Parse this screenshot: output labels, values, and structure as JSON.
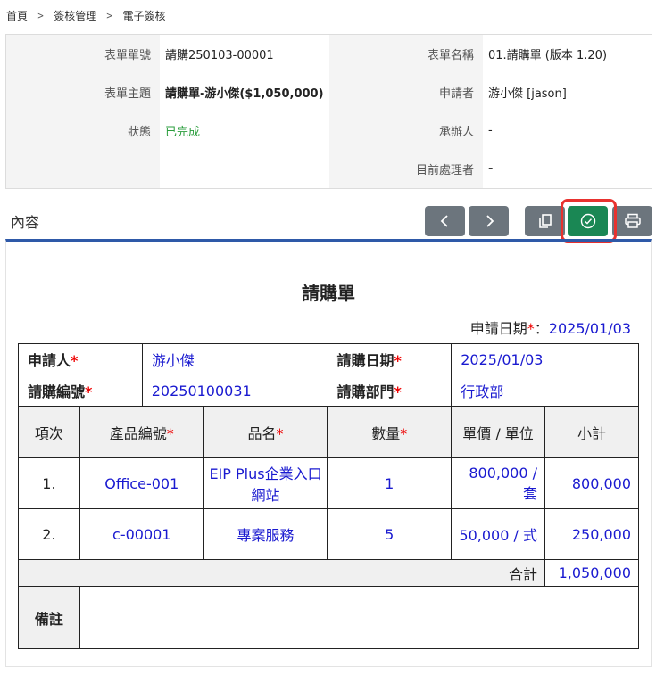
{
  "breadcrumb": {
    "home": "首頁",
    "sep": ">",
    "module": "簽核管理",
    "current": "電子簽核"
  },
  "info": {
    "form_no_label": "表單單號",
    "form_no": "請購250103-00001",
    "form_name_label": "表單名稱",
    "form_name": "01.請購單 (版本 1.20)",
    "subject_label": "表單主題",
    "subject": "請購單-游小傑($1,050,000)",
    "applicant_label": "申請者",
    "applicant": "游小傑 [jason]",
    "status_label": "狀態",
    "status": "已完成",
    "handler_label": "承辦人",
    "handler": "-",
    "current_label": "目前處理者",
    "current": "-"
  },
  "section": {
    "title": "內容"
  },
  "toolbar": {
    "prev_icon": "chevron-left-icon",
    "next_icon": "chevron-right-icon",
    "copy_icon": "copy-icon",
    "approve_icon": "check-circle-icon",
    "print_icon": "print-icon"
  },
  "colors": {
    "approve_green": "#1a8754",
    "highlight_red": "#e8322f",
    "link_blue": "#1a1ad0",
    "status_green": "#2a9d3c",
    "accent_blue": "#2e59a8"
  },
  "form": {
    "title": "請購單",
    "apply_date_label": "申請日期",
    "apply_date": "2025/01/03",
    "applicant_label": "申請人",
    "applicant": "游小傑",
    "request_date_label": "請購日期",
    "request_date": "2025/01/03",
    "request_no_label": "請購編號",
    "request_no": "20250100031",
    "dept_label": "請購部門",
    "dept": "行政部",
    "headers": {
      "item": "項次",
      "code": "產品編號",
      "name": "品名",
      "qty": "數量",
      "price": "單價 / 單位",
      "subtotal": "小計"
    },
    "rows": [
      {
        "no": "1.",
        "code": "Office-001",
        "name": "EIP Plus企業入口網站",
        "qty": "1",
        "price": "800,000 / 套",
        "subtotal": "800,000"
      },
      {
        "no": "2.",
        "code": "c-00001",
        "name": "專案服務",
        "qty": "5",
        "price": "50,000 / 式",
        "subtotal": "250,000"
      }
    ],
    "total_label": "合計",
    "total": "1,050,000",
    "note_label": "備註",
    "note": ""
  }
}
